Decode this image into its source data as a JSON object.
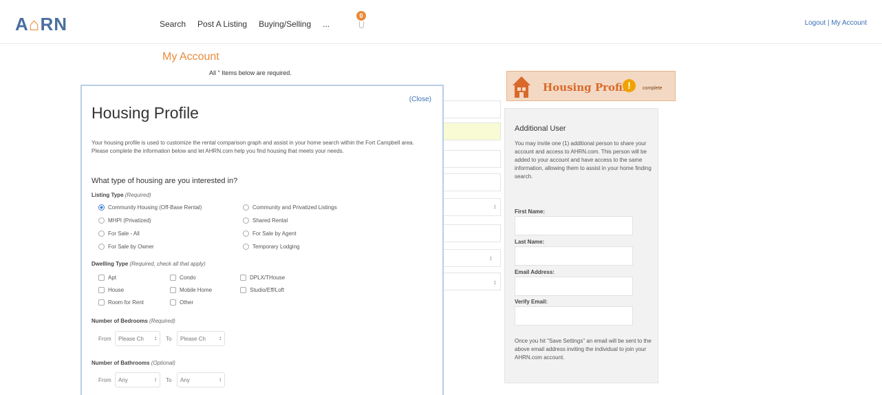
{
  "header": {
    "logo_prefix": "A",
    "logo_house": "⌂",
    "logo_suffix": "RN",
    "nav": [
      "Search",
      "Post A Listing",
      "Buying/Selling",
      "..."
    ],
    "notification_count": "0",
    "account_links": "Logout | My Account"
  },
  "page": {
    "title": "My Account",
    "required_note": "All \" Items below are required."
  },
  "modal": {
    "close": "(Close)",
    "title": "Housing Profile",
    "description": "Your housing profile is used to customize the rental comparison graph and assist in your home search within the Fort Campbell area. Please complete the information below and let AHRN.com help you find housing that meets your needs.",
    "question": "What type of housing are you interested in?",
    "listing_type": {
      "label": "Listing Type",
      "hint": "(Required)",
      "options_left": [
        "Community Housing (Off-Base Rental)",
        "MHPI (Privatized)",
        "For Sale - All",
        "For Sale by Owner"
      ],
      "options_right": [
        "Community and Privatized Listings",
        "Shared Rental",
        "For Sale by Agent",
        "Temporary Lodging"
      ],
      "selected": "Community Housing (Off-Base Rental)"
    },
    "dwelling_type": {
      "label": "Dwelling Type",
      "hint": "(Required, check all that apply)",
      "col1": [
        "Apt",
        "House",
        "Room for Rent"
      ],
      "col2": [
        "Condo",
        "Mobile Home",
        "Other"
      ],
      "col3": [
        "DPLX/THouse",
        "Studio/Eff/Loft"
      ]
    },
    "bedrooms": {
      "label": "Number of Bedrooms",
      "hint": "(Required)",
      "from_label": "From",
      "to_label": "To",
      "from_value": "Please Ch",
      "to_value": "Please Ch"
    },
    "bathrooms": {
      "label": "Number of Bathrooms",
      "hint": "(Optional)",
      "from_label": "From",
      "to_label": "To",
      "from_value": "Any",
      "to_value": "Any"
    }
  },
  "banner": {
    "text": "Housing Profile",
    "alert": "!",
    "sub": "complete"
  },
  "panel": {
    "title": "Additional User",
    "text": "You may invite one (1) additional person to share your account and access to AHRN.com. This person will be added to your account and have access to the same information, allowing them to assist in your home finding search.",
    "fields": [
      "First Name:",
      "Last Name:",
      "Email Address:",
      "Verify Email:"
    ],
    "note": "Once you hit \"Save Settings\" an email will be sent to the above email address inviting the individual to join your AHRN.com account."
  },
  "colors": {
    "accent": "#e98a3b",
    "link": "#3b6fb6",
    "logo": "#4a6fa0"
  }
}
